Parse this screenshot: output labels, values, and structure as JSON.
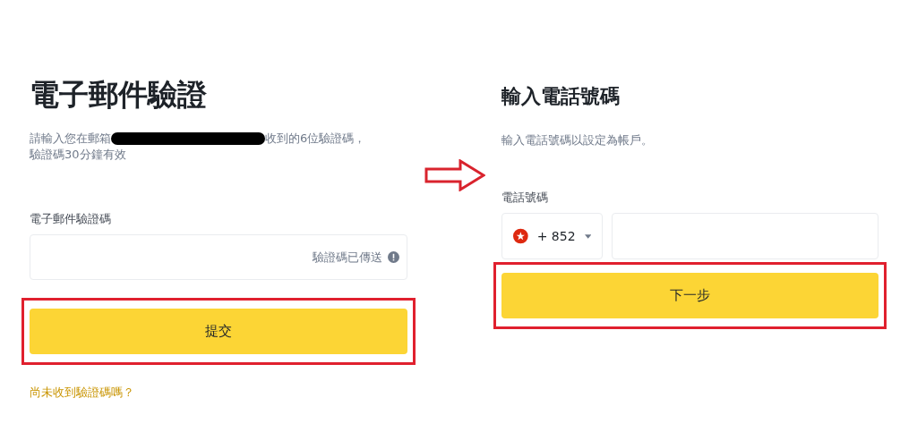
{
  "email_panel": {
    "title": "電子郵件驗證",
    "instruction_start": "請輸入您在郵箱",
    "instruction_end": "收到的6位驗證碼，",
    "instruction_line2": "驗證碼30分鐘有效",
    "code_field": {
      "label": "電子郵件驗證碼",
      "status": "驗證碼已傳送"
    },
    "submit_button": {
      "label": "提交",
      "highlighted": true
    },
    "resend_link": "尚未收到驗證碼嗎？"
  },
  "phone_panel": {
    "title": "輸入電話號碼",
    "description": "輸入電話號碼以設定為帳戶。",
    "phone_field": {
      "label": "電話號碼",
      "country_code": "+ 852"
    },
    "next_button": {
      "label": "下一步",
      "highlighted": true
    }
  }
}
